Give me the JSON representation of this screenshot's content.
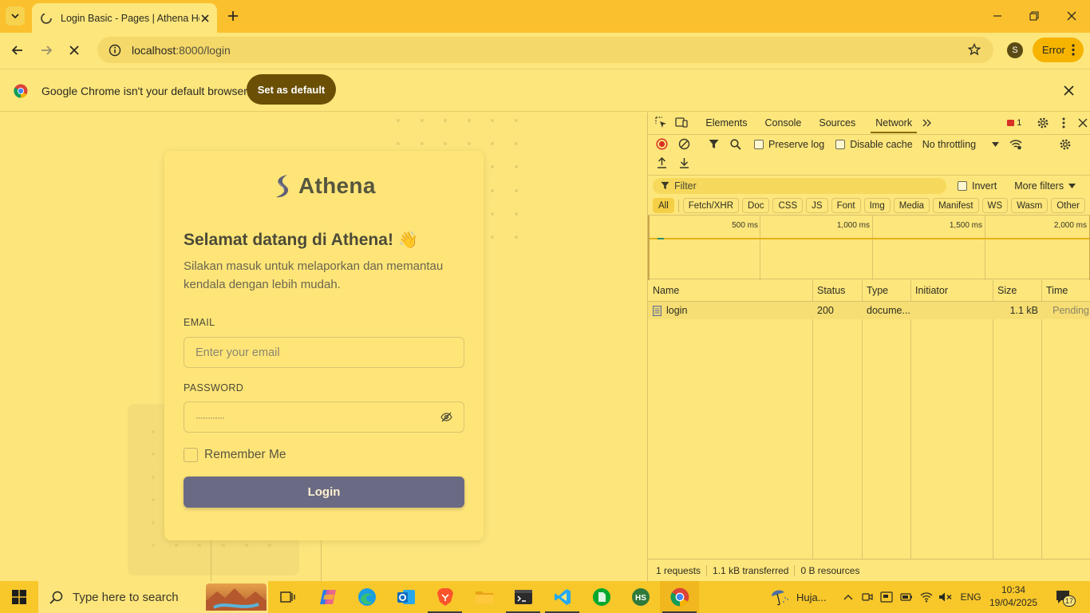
{
  "browser": {
    "tab_title": "Login Basic - Pages | Athena He",
    "url_host": "localhost",
    "url_path": ":8000/login",
    "profile_initial": "S",
    "error_label": "Error",
    "infobar_message": "Google Chrome isn't your default browser",
    "set_default_label": "Set as default"
  },
  "page": {
    "brand": "Athena",
    "welcome": "Selamat datang di Athena!",
    "welcome_emoji": "👋",
    "subtitle": "Silakan masuk untuk melaporkan dan memantau kendala dengan lebih mudah.",
    "email_label": "EMAIL",
    "email_placeholder": "Enter your email",
    "password_label": "PASSWORD",
    "password_mask": "············",
    "remember_label": "Remember Me",
    "login_label": "Login"
  },
  "devtools": {
    "tabs": [
      "Elements",
      "Console",
      "Sources",
      "Network"
    ],
    "active_tab": "Network",
    "error_count": "1",
    "preserve_log": "Preserve log",
    "disable_cache": "Disable cache",
    "throttling": "No throttling",
    "filter_placeholder": "Filter",
    "invert": "Invert",
    "more_filters": "More filters",
    "type_filters": [
      "All",
      "Fetch/XHR",
      "Doc",
      "CSS",
      "JS",
      "Font",
      "Img",
      "Media",
      "Manifest",
      "WS",
      "Wasm",
      "Other"
    ],
    "timeline_ticks": [
      "500 ms",
      "1,000 ms",
      "1,500 ms",
      "2,000 ms"
    ],
    "columns": [
      "Name",
      "Status",
      "Type",
      "Initiator",
      "Size",
      "Time"
    ],
    "rows": [
      {
        "name": "login",
        "status": "200",
        "type": "docume...",
        "initiator": "",
        "size": "1.1 kB",
        "time": "Pending"
      }
    ],
    "summary": {
      "requests": "1 requests",
      "transferred": "1.1 kB transferred",
      "resources": "0 B resources"
    }
  },
  "taskbar": {
    "search_placeholder": "Type here to search",
    "weather": "Huja...",
    "language": "ENG",
    "time": "10:34",
    "date": "19/04/2025",
    "notification_count": "17",
    "apps": [
      "task-view",
      "copilot",
      "edge",
      "outlook",
      "brave",
      "file-explorer",
      "terminal",
      "vscode",
      "evernote",
      "heidisql",
      "chrome"
    ]
  },
  "colors": {
    "theme_yellow": "#fde57c",
    "tabstrip": "#fbc02d",
    "login_button": "#6b6a85",
    "set_default_button": "#6a4f05",
    "error_button": "#f6b300"
  }
}
